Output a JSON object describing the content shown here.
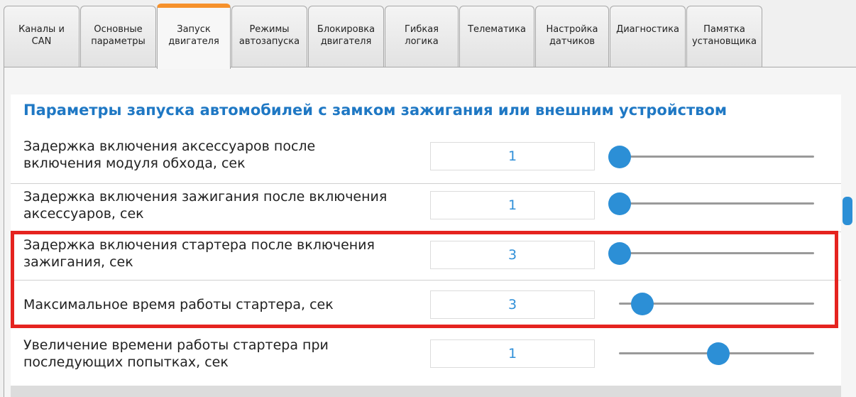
{
  "tabs": [
    {
      "label": "Каналы и\nCAN"
    },
    {
      "label": "Основные\nпараметры"
    },
    {
      "label": "Запуск\nдвигателя"
    },
    {
      "label": "Режимы\nавтозапуска"
    },
    {
      "label": "Блокировка\nдвигателя"
    },
    {
      "label": "Гибкая\nлогика"
    },
    {
      "label": "Телематика"
    },
    {
      "label": "Настройка\nдатчиков"
    },
    {
      "label": "Диагностика"
    },
    {
      "label": "Памятка\nустановщика"
    }
  ],
  "active_tab": "Запуск\nдвигателя",
  "section_title": "Параметры запуска автомобилей с замком зажигания или внешним устройством",
  "rows": [
    {
      "label": "Задержка включения аксессуаров после\nвключения модуля обхода, сек",
      "value": "1",
      "slider_fraction": 0.0
    },
    {
      "label": "Задержка включения зажигания после включения\nаксессуаров, сек",
      "value": "1",
      "slider_fraction": 0.0
    },
    {
      "label": "Задержка включения стартера после включения\nзажигания, сек",
      "value": "3",
      "slider_fraction": 0.0
    },
    {
      "label": "Максимальное время работы стартера, сек",
      "value": "3",
      "slider_fraction": 0.12
    },
    {
      "label": "Увеличение времени работы стартера при\nпоследующих попытках, сек",
      "value": "1",
      "slider_fraction": 0.52
    }
  ],
  "colors": {
    "accent": "#1f78c4",
    "slider": "#2c8fd6",
    "active_tab": "#f6912b",
    "highlight": "#e5231f"
  }
}
